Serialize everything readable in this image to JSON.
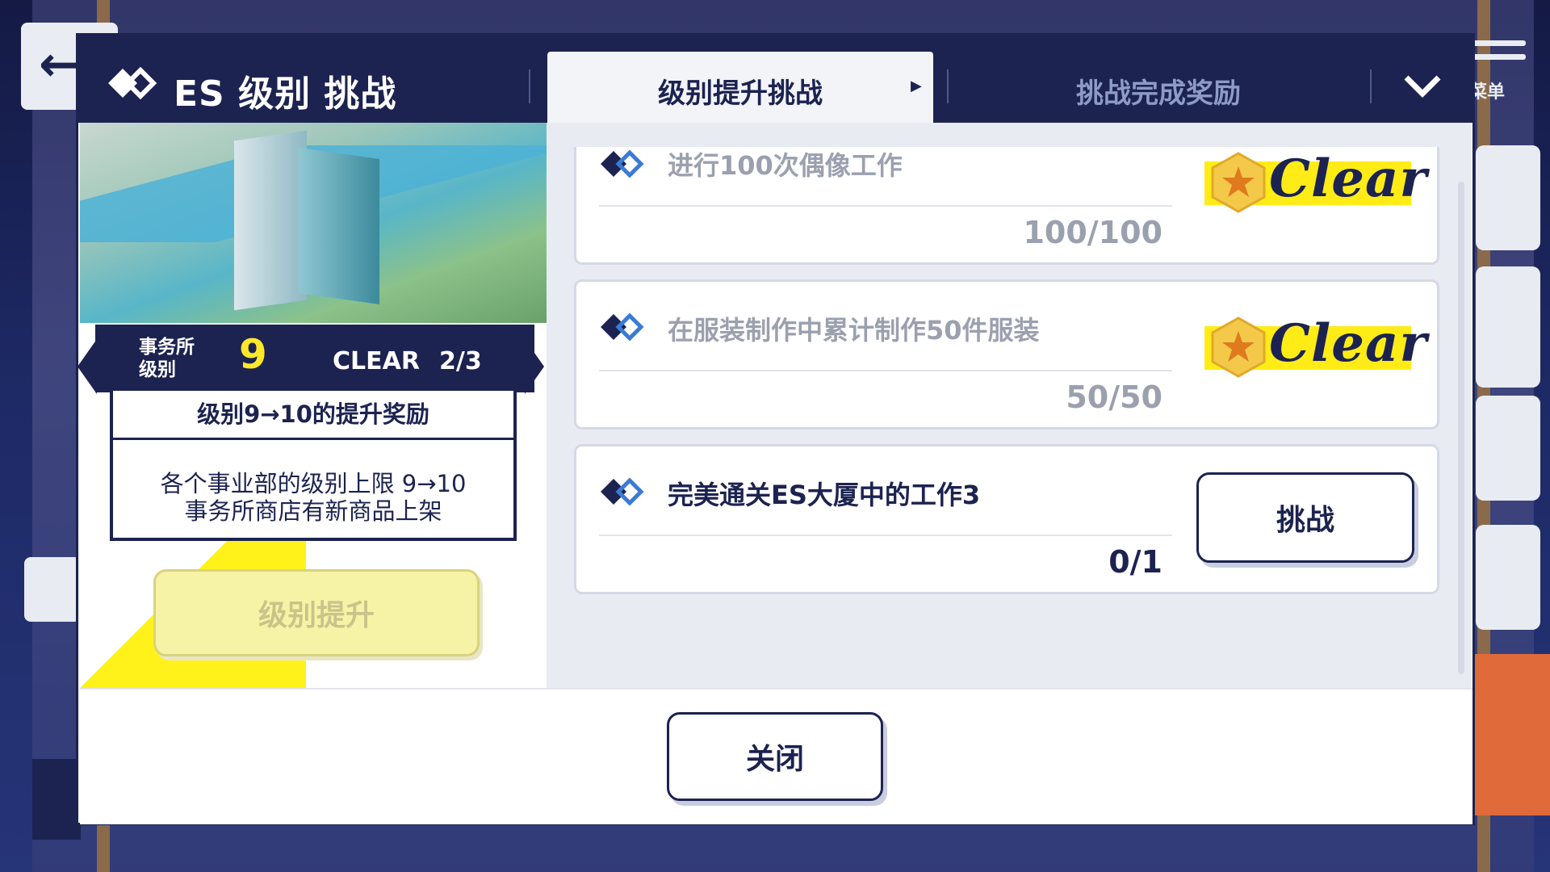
{
  "header": {
    "title": "ES 级别 挑战",
    "tabs": [
      {
        "label": "级别提升挑战",
        "active": true
      },
      {
        "label": "挑战完成奖励",
        "active": false
      }
    ]
  },
  "background": {
    "menu_label": "菜单"
  },
  "level_panel": {
    "office_level_label": "事务所\n级别",
    "level": "9",
    "clear_label": "CLEAR",
    "clear_count": "2/3",
    "reward_title": "级别9→10的提升奖励",
    "reward_line1": "各个事业部的级别上限 9→10",
    "reward_line2": "事务所商店有新商品上架",
    "levelup_button": "级别提升"
  },
  "challenges": [
    {
      "text": "进行100次偶像工作",
      "progress": "100/100",
      "status": "clear",
      "badge": "Clear"
    },
    {
      "text": "在服装制作中累计制作50件服装",
      "progress": "50/50",
      "status": "clear",
      "badge": "Clear"
    },
    {
      "text": "完美通关ES大厦中的工作3",
      "progress": "0/1",
      "status": "open",
      "button": "挑战"
    }
  ],
  "footer": {
    "close_button": "关闭"
  },
  "colors": {
    "navy": "#1c2350",
    "yellow": "#ffec17",
    "card_border": "#d4d9e6",
    "muted_text": "#9aa0ae"
  }
}
